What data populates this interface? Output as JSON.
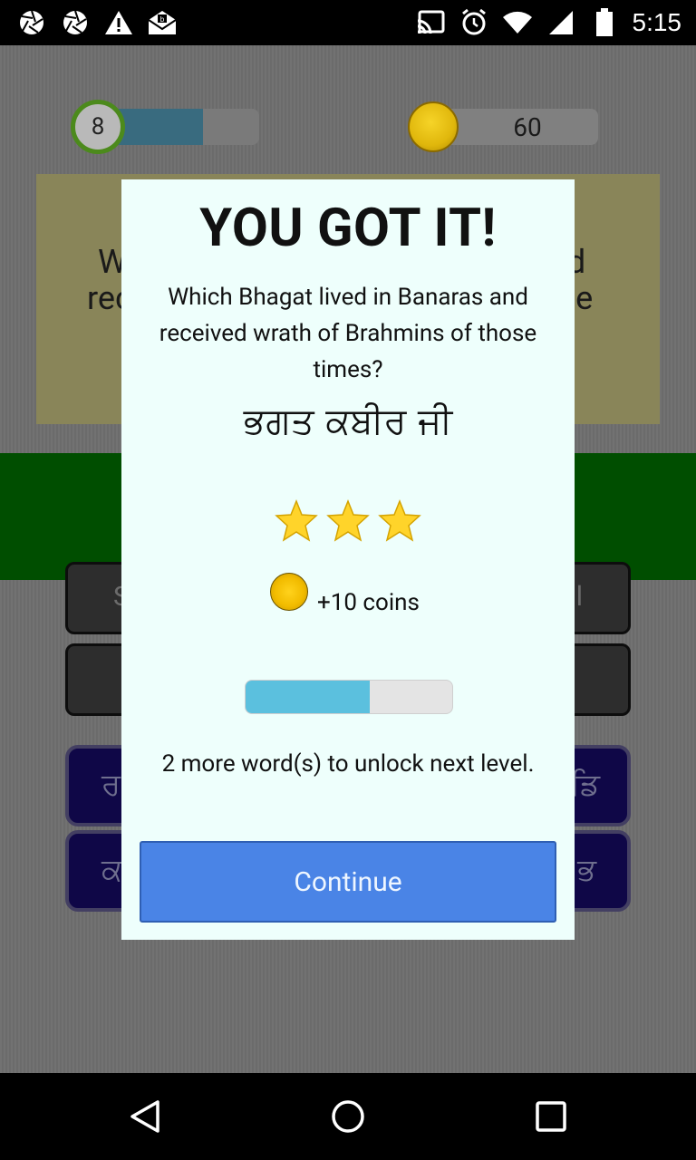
{
  "status_bar": {
    "time": "5:15",
    "left_icons": [
      "aperture-icon",
      "aperture-icon",
      "warning-icon",
      "mail-icon"
    ],
    "right_icons": [
      "cast-icon",
      "alarm-icon",
      "wifi-icon",
      "signal-icon",
      "battery-icon"
    ]
  },
  "hud": {
    "level": "8",
    "level_progress": 0.65,
    "coins": "60"
  },
  "background": {
    "question_left_frag_1": "W",
    "question_left_frag_2": "rec",
    "question_right_frag_1": "nd",
    "question_right_frag_2": "ose",
    "slot_left_1": "S",
    "slot_right_1": "l",
    "letter_left_1": "ਰ",
    "letter_right_1": "ਡਿ",
    "letter_left_2": "ਕ",
    "letter_right_2": "ਭ"
  },
  "dialog": {
    "title": "YOU GOT IT!",
    "question": "Which Bhagat lived in Banaras and received wrath of Brahmins of those times?",
    "answer": "ਭਗਤ ਕਬੀਰ ਜੀ",
    "stars_earned": 3,
    "coins_reward": "+10 coins",
    "level_progress": 0.6,
    "unlock_text": "2 more word(s) to unlock next level.",
    "continue_label": "Continue"
  },
  "colors": {
    "dialog_bg": "#eefffc",
    "continue_button": "#4a84e6",
    "progress_fill": "#5bc0de",
    "green_band": "#006400",
    "question_box": "#b0ab72"
  },
  "nav": {
    "icons": [
      "back-icon",
      "home-icon",
      "recents-icon"
    ]
  }
}
